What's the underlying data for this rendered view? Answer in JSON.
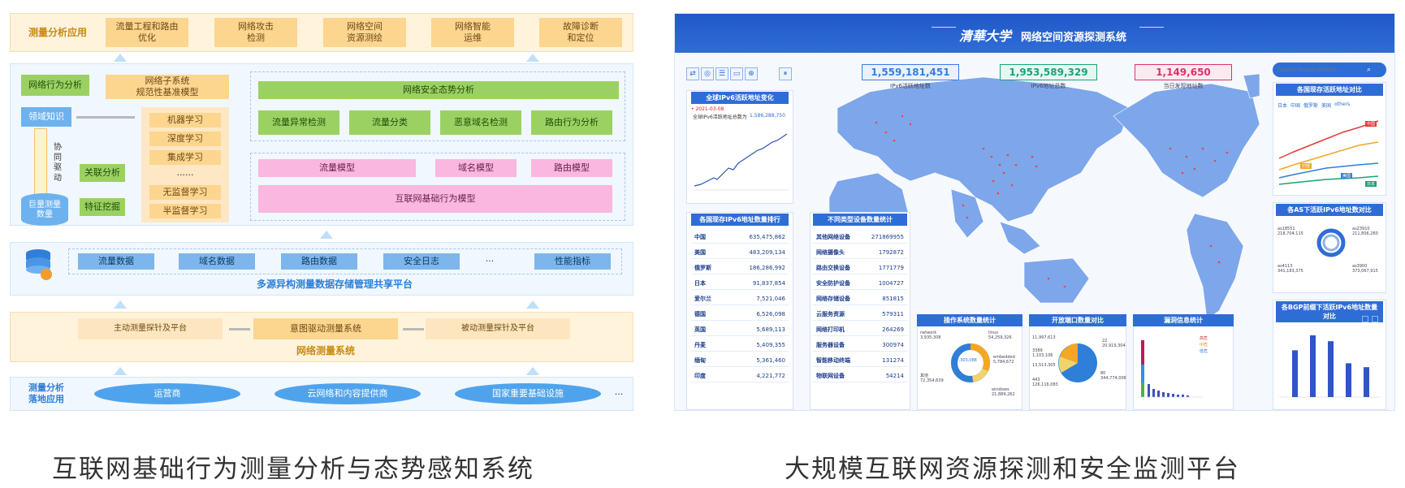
{
  "left_diagram": {
    "top_label": "测量分析应用",
    "apps": [
      "流量工程和路由\n优化",
      "网络攻击\n检测",
      "网络空间\n资源测绘",
      "网络智能\n运维",
      "故障诊断\n和定位"
    ],
    "behavior": "网络行为分析",
    "subsystem": "网络子系统\n规范性基准模型",
    "domain_knowledge": "领域知识",
    "collab": "协\n同\n驱\n动",
    "ml_methods": [
      "机器学习",
      "深度学习",
      "集成学习",
      "······",
      "无监督学习",
      "半监督学习"
    ],
    "assoc": "关联分析",
    "feature": "特征挖掘",
    "bigdata": "巨量测量\n数量",
    "security_title": "网络安全态势分析",
    "security_items": [
      "流量异常检测",
      "流量分类",
      "恶意域名检测",
      "路由行为分析"
    ],
    "models": [
      "流量模型",
      "域名模型",
      "路由模型"
    ],
    "base_model": "互联网基础行为模型",
    "data_items": [
      "流量数据",
      "域名数据",
      "路由数据",
      "安全日志",
      "···",
      "性能指标"
    ],
    "platform": "多源异构测量数据存储管理共享平台",
    "probes": [
      "主动测量探针及平台",
      "意图驱动测量系统",
      "被动测量探针及平台"
    ],
    "measure_sys": "网络测量系统",
    "landing_label": "测量分析\n落地应用",
    "landing_items": [
      "运营商",
      "云网络和内容提供商",
      "国家重要基础设施",
      "···"
    ],
    "caption": "互联网基础行为测量分析与态势感知系统"
  },
  "dashboard": {
    "logo": "清華大学",
    "title": "网络空间资源探测系统",
    "search_placeholder": "Search Domain,IP,Host...",
    "pause": "⏸",
    "stats": [
      {
        "value": "1,559,181,451",
        "label": "IPv6活跃地址数",
        "color": "#3a7de0",
        "bg": "#e8f1fd"
      },
      {
        "value": "1,953,589,329",
        "label": "IPv6地址总数",
        "color": "#1aa37a",
        "bg": "#e6f7f1"
      },
      {
        "value": "1,149,650",
        "label": "当日发现地址数",
        "color": "#d9346b",
        "bg": "#fde9f0"
      }
    ],
    "trend_title": "全球IPv6活跃地址变化",
    "trend_date": "• 2021-03-08",
    "trend_note": "全球IPv6活跃地址总数为",
    "trend_value": "1,586,288,750",
    "rank_title": "各国现存IPv6地址数量排行",
    "countries": [
      {
        "name": "中国",
        "value": "635,475,862"
      },
      {
        "name": "美国",
        "value": "483,209,134"
      },
      {
        "name": "俄罗斯",
        "value": "186,286,992"
      },
      {
        "name": "日本",
        "value": "91,837,854"
      },
      {
        "name": "爱尔兰",
        "value": "7,521,046"
      },
      {
        "name": "德国",
        "value": "6,526,098"
      },
      {
        "name": "英国",
        "value": "5,689,113"
      },
      {
        "name": "丹麦",
        "value": "5,409,355"
      },
      {
        "name": "缅甸",
        "value": "5,361,460"
      },
      {
        "name": "印度",
        "value": "4,221,772"
      }
    ],
    "device_title": "不同类型设备数量统计",
    "devices": [
      {
        "name": "其他网络设备",
        "value": "271869955"
      },
      {
        "name": "网络摄像头",
        "value": "1792872"
      },
      {
        "name": "路由交换设备",
        "value": "1771779"
      },
      {
        "name": "安全防护设备",
        "value": "1004727"
      },
      {
        "name": "网络存储设备",
        "value": "851815"
      },
      {
        "name": "云服务资源",
        "value": "579311"
      },
      {
        "name": "网络打印机",
        "value": "264269"
      },
      {
        "name": "服务器设备",
        "value": "300974"
      },
      {
        "name": "智能移动终端",
        "value": "131274"
      },
      {
        "name": "物联网设备",
        "value": "54214"
      }
    ],
    "os_title": "操作系统数量统计",
    "os_labels": [
      "network\n3,935,308",
      "linux\n54,259,326",
      "137,303,088",
      "embedded\n5,784,672",
      "其他\n72,354,639",
      "windows\n21,889,262"
    ],
    "port_title": "开放端口数量对比",
    "port_labels": [
      "11,997,613",
      "22\n20,919,304",
      "3389\n1,103,106",
      "13,513,305",
      "443\n126,116,083",
      "80\n344,774,006"
    ],
    "vuln_title": "漏洞信息统计",
    "vuln_legend": [
      "高危",
      "中危",
      "低危"
    ],
    "country_trend_title": "各国现存活跃地址对比",
    "country_tabs": [
      "日本",
      "中国",
      "俄罗斯",
      "美国",
      "others"
    ],
    "country_trend_tags": [
      "中国",
      "印度",
      "美国",
      "日本"
    ],
    "as_title": "各AS下活跃IPv6地址数对比",
    "as_labels": [
      "as18551\n218,704,115",
      "as23910\n211,806,260",
      "as4113\n341,183,375",
      "as3900\n373,067,915"
    ],
    "bgp_title": "各BGP前缀下活跃IPv6地址数量对比",
    "bgp_bars": [
      0.72,
      0.95,
      0.86,
      0.52,
      0.46
    ],
    "caption": "大规模互联网资源探测和安全监测平台"
  }
}
